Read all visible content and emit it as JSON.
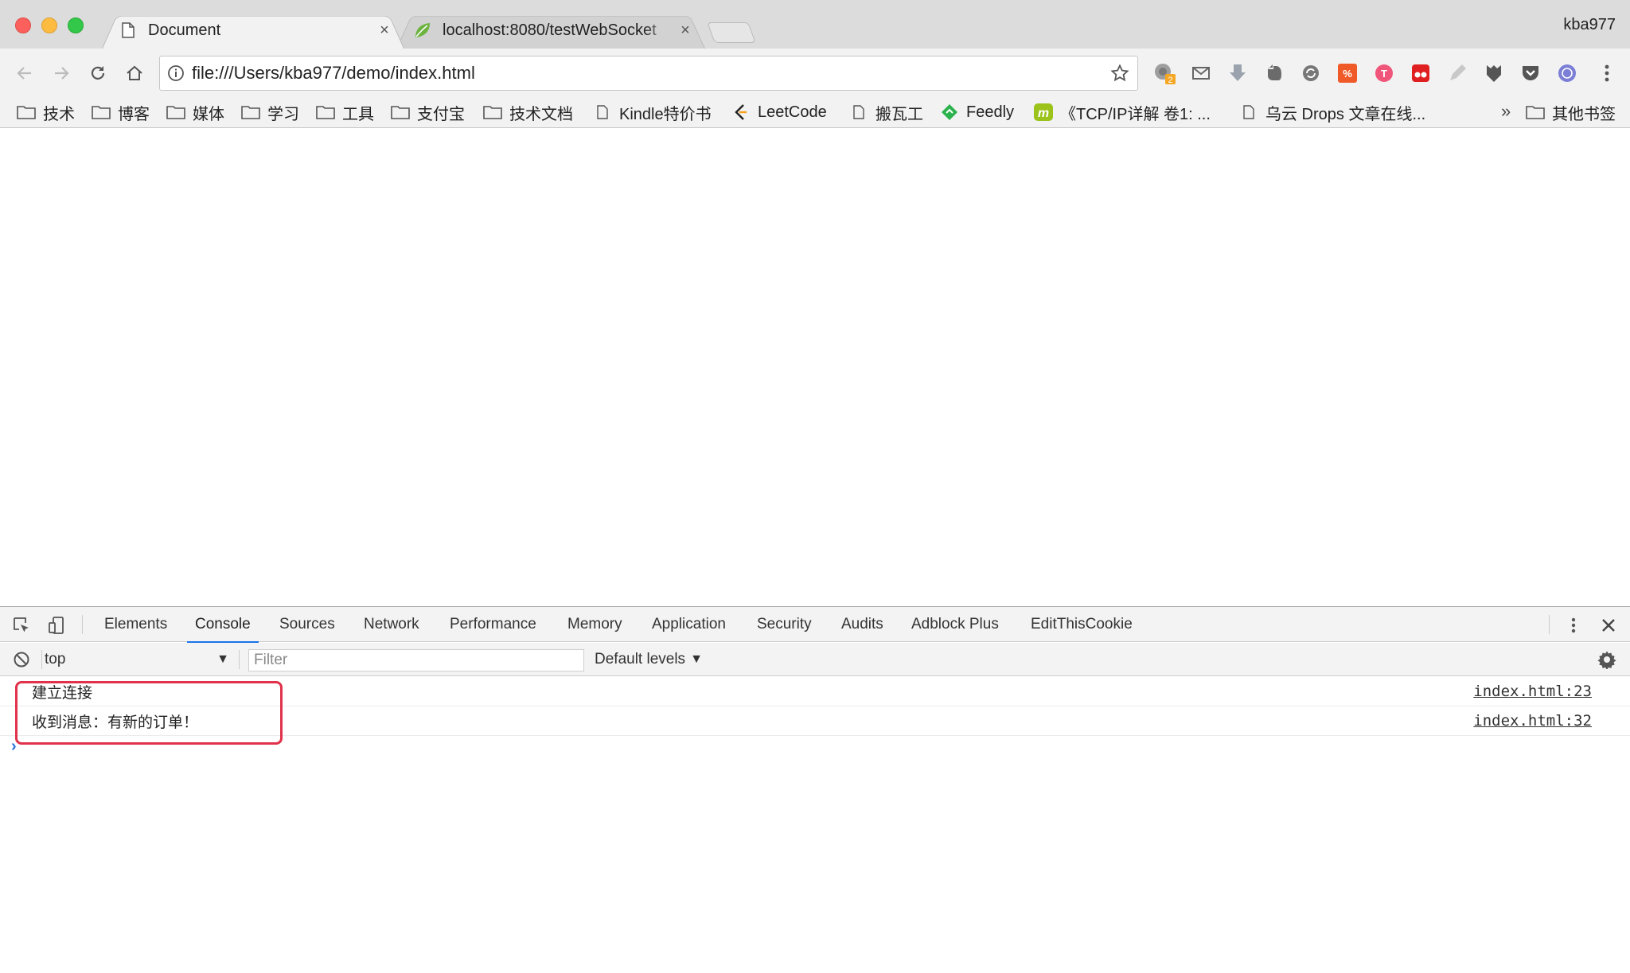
{
  "window": {
    "profile_name": "kba977"
  },
  "tabs": [
    {
      "title": "Document",
      "favicon": "page-icon",
      "close": "×"
    },
    {
      "title": "localhost:8080/testWebSocket",
      "favicon": "spring-leaf-icon",
      "close": "×"
    }
  ],
  "toolbar": {
    "url": "file:///Users/kba977/demo/index.html",
    "extension_badge": "2"
  },
  "bookmarks": {
    "items": [
      {
        "label": "技术",
        "icon": "folder-icon"
      },
      {
        "label": "博客",
        "icon": "folder-icon"
      },
      {
        "label": "媒体",
        "icon": "folder-icon"
      },
      {
        "label": "学习",
        "icon": "folder-icon"
      },
      {
        "label": "工具",
        "icon": "folder-icon"
      },
      {
        "label": "支付宝",
        "icon": "folder-icon"
      },
      {
        "label": "技术文档",
        "icon": "folder-icon"
      },
      {
        "label": "Kindle特价书",
        "icon": "page-icon"
      },
      {
        "label": "LeetCode",
        "icon": "leetcode-icon"
      },
      {
        "label": "搬瓦工",
        "icon": "page-icon"
      },
      {
        "label": "Feedly",
        "icon": "feedly-icon"
      },
      {
        "label": "《TCP/IP详解 卷1: ...",
        "icon": "m-logo-icon"
      },
      {
        "label": "乌云 Drops 文章在线...",
        "icon": "page-icon"
      }
    ],
    "more": "»",
    "other": "其他书签"
  },
  "devtools": {
    "tabs": [
      "Elements",
      "Console",
      "Sources",
      "Network",
      "Performance",
      "Memory",
      "Application",
      "Security",
      "Audits",
      "Adblock Plus",
      "EditThisCookie"
    ],
    "active_tab": "Console",
    "context": "top",
    "filter_placeholder": "Filter",
    "levels": "Default levels",
    "messages": [
      {
        "text": "建立连接",
        "source": "index.html:23"
      },
      {
        "text": "收到消息：有新的订单！",
        "source": "index.html:32"
      }
    ],
    "prompt": "›",
    "highlight_color": "#e0324a"
  },
  "colors": {
    "accent": "#1a73e8",
    "close_red": "#fc605c",
    "minimize_yellow": "#fdbc40",
    "zoom_green": "#34c84a"
  }
}
